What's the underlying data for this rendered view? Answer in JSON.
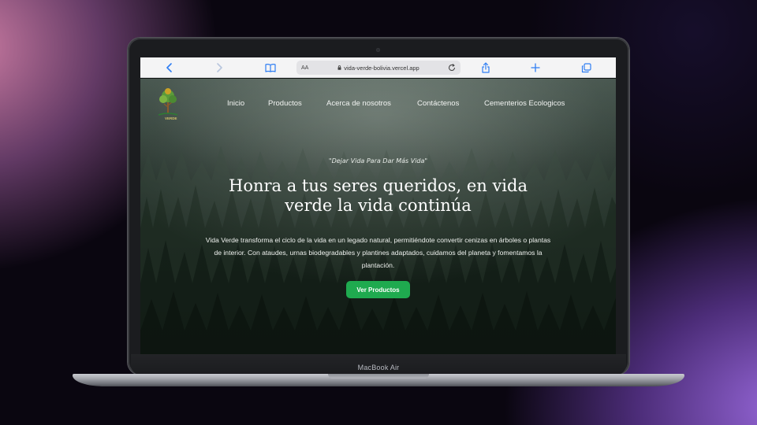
{
  "device": {
    "model_label": "MacBook Air"
  },
  "browser": {
    "aa_label": "AA",
    "url": "vida-verde-bolivia.vercel.app",
    "icons": [
      "back-icon",
      "forward-icon",
      "bookmarks-icon",
      "lock-icon",
      "reload-icon",
      "share-icon",
      "new-tab-icon",
      "tabs-icon"
    ]
  },
  "site": {
    "logo_text": "VERDE",
    "nav": [
      {
        "label": "Inicio"
      },
      {
        "label": "Productos"
      },
      {
        "label": "Acerca de nosotros"
      },
      {
        "label": "Contáctenos"
      },
      {
        "label": "Cementerios Ecologicos"
      }
    ],
    "tagline": "\"Dejar Vida Para Dar Más Vida\"",
    "headline_line1": "Honra a tus seres queridos, en vida",
    "headline_line2": "verde la vida continúa",
    "description": "Vida Verde transforma el ciclo de la vida en un legado natural, permitiéndote convertir cenizas en árboles o plantas de interior. Con ataudes, urnas biodegradables y plantines adaptados, cuidamos del planeta y fomentamos la plantación.",
    "cta_label": "Ver Productos"
  },
  "colors": {
    "accent_blue": "#2f7ef3",
    "cta_green": "#1faa4f",
    "forest_dark": "#16221b"
  }
}
